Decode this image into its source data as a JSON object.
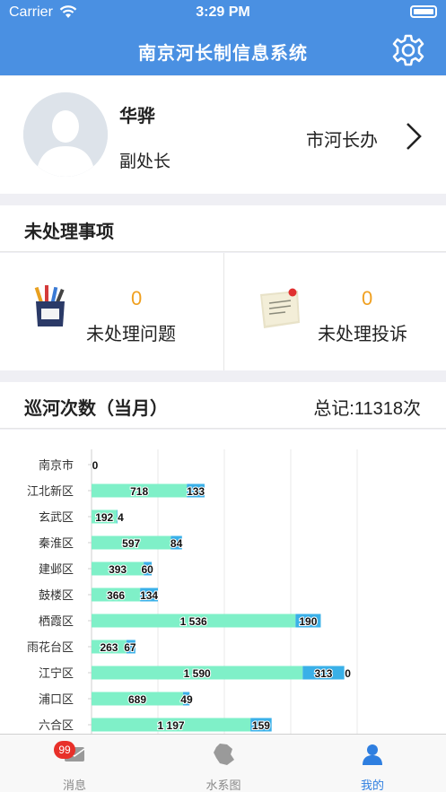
{
  "status": {
    "carrier": "Carrier",
    "time": "3:29 PM"
  },
  "nav": {
    "title": "南京河长制信息系统"
  },
  "profile": {
    "name": "华骅",
    "role": "副处长",
    "org": "市河长办"
  },
  "todo": {
    "title": "未处理事项",
    "problems": {
      "count": "0",
      "label": "未处理问题"
    },
    "complaints": {
      "count": "0",
      "label": "未处理投诉"
    }
  },
  "patrol": {
    "title": "巡河次数（当月）",
    "total": "总记:11318次"
  },
  "colors": {
    "primary": "#4a90e2",
    "bar_main": "#7ff0c8",
    "bar_second": "#3ab0e8",
    "badge": "#e8302a",
    "count": "#f0a020"
  },
  "chart_data": {
    "type": "bar",
    "orientation": "horizontal",
    "stacked": true,
    "categories": [
      "南京市",
      "江北新区",
      "玄武区",
      "秦淮区",
      "建邺区",
      "鼓楼区",
      "栖霞区",
      "雨花台区",
      "江宁区",
      "浦口区",
      "六合区"
    ],
    "series": [
      {
        "values": [
          0,
          718,
          192,
          597,
          393,
          366,
          1536,
          263,
          1590,
          689,
          1197
        ]
      },
      {
        "values": [
          null,
          133,
          4,
          84,
          60,
          134,
          190,
          67,
          313,
          49,
          159
        ]
      },
      {
        "values": [
          null,
          null,
          null,
          null,
          null,
          null,
          null,
          null,
          0,
          null,
          null
        ]
      }
    ],
    "xlim": [
      0,
      2000
    ],
    "grid": true
  },
  "tabs": [
    {
      "label": "消息",
      "icon": "message-icon",
      "badge": "99"
    },
    {
      "label": "水系图",
      "icon": "map-icon"
    },
    {
      "label": "我的",
      "icon": "user-icon"
    }
  ]
}
